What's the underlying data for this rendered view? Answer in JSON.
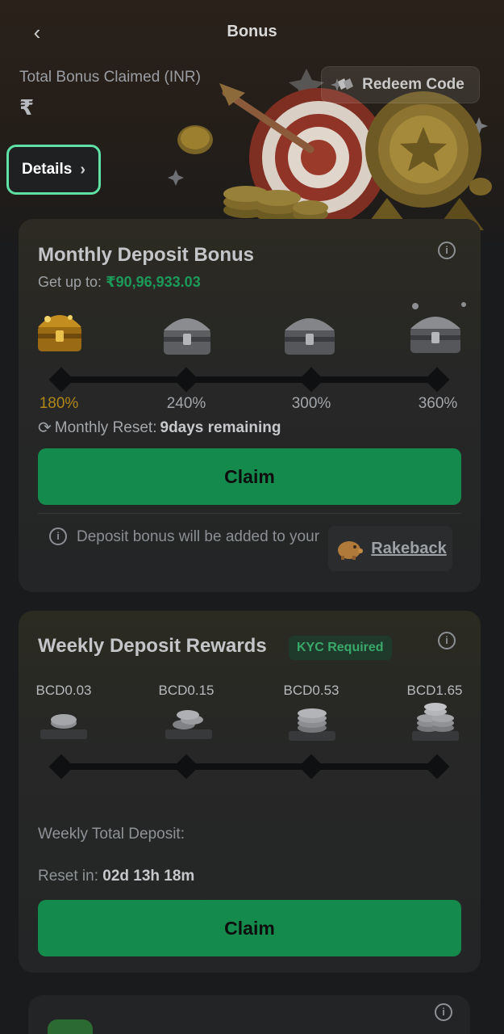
{
  "header": {
    "title": "Bonus",
    "back_icon": "chevron-left-icon"
  },
  "summary": {
    "total_label": "Total Bonus Claimed (INR)",
    "total_value": "₹",
    "redeem_label": "Redeem Code",
    "details_label": "Details"
  },
  "monthly": {
    "title": "Monthly Deposit Bonus",
    "getup_label": "Get up to:",
    "getup_amount": "₹90,96,933.03",
    "tiers": [
      "180%",
      "240%",
      "300%",
      "360%"
    ],
    "active_tier_index": 0,
    "reset_label": "Monthly Reset:",
    "reset_value": "9days remaining",
    "claim_label": "Claim",
    "note_text": "Deposit bonus will be added to your",
    "rakeback_label": "Rakeback"
  },
  "weekly": {
    "title": "Weekly Deposit Rewards",
    "kyc_badge": "KYC Required",
    "rewards": [
      "BCD0.03",
      "BCD0.15",
      "BCD0.53",
      "BCD1.65"
    ],
    "total_deposit_label": "Weekly Total Deposit:",
    "reset_label": "Reset in:",
    "reset_value": "02d 13h 18m",
    "claim_label": "Claim"
  },
  "colors": {
    "accent_green": "#158a4d",
    "amount_green": "#1c9a5a",
    "gold": "#b2871a",
    "details_border": "#5fe0a4"
  }
}
